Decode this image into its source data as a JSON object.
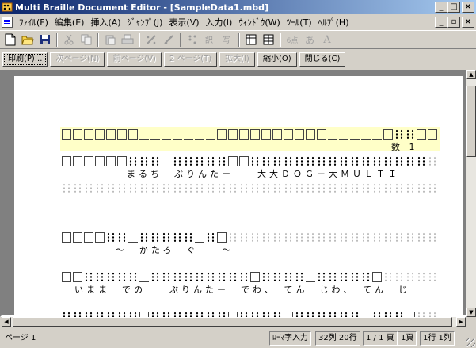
{
  "window": {
    "title": "Multi Braille Document Editor - [SampleData1.mbd]",
    "controls": {
      "minimize": "_",
      "restore": "□",
      "close": "×"
    }
  },
  "menu": {
    "items": [
      "ﾌｧｲﾙ(F)",
      "編集(E)",
      "挿入(A)",
      "ｼﾞｬﾝﾌﾟ(J)",
      "表示(V)",
      "入力(I)",
      "ｳｨﾝﾄﾞｳ(W)",
      "ﾂｰﾙ(T)",
      "ﾍﾙﾌﾟ(H)"
    ],
    "mdi_controls": {
      "minimize": "_",
      "restore": "▫",
      "close": "×"
    }
  },
  "toolbar": {
    "new_icon": "new-document-icon",
    "open_icon": "open-folder-icon",
    "save_icon": "save-icon",
    "cut_icon": "cut-icon",
    "copy_icon": "copy-icon",
    "paste_icon": "paste-icon",
    "print_icon": "print-icon",
    "kana_label": "6点",
    "hiragana_label": "あ",
    "latin_label": "A"
  },
  "preview_nav": {
    "print": "印刷(P)...",
    "next_page": "次ページ(N)",
    "prev_page": "前ページ(V)",
    "two_page": "2 ページ(T)",
    "zoom_in": "拡大(I)",
    "zoom_out": "縮小(O)",
    "close": "閉じる(C)"
  },
  "document": {
    "rows": [
      {
        "ink": "数 1",
        "highlighted": true
      },
      {
        "ink": "まるち　ぶりんたー　　大大ＤＯＧ－大ＭＵＬＴＩ",
        "highlighted": false
      },
      {
        "ink": "",
        "highlighted": false
      },
      {
        "ink": "～　かたろ　ぐ　　～",
        "highlighted": false
      },
      {
        "ink": "いまま　での　　ぶりんたー　でわ、　てん　じわ、　てん　じ",
        "highlighted": false
      },
      {
        "ink": "",
        "highlighted": false
      }
    ]
  },
  "status": {
    "page": "ページ 1",
    "input_mode": "ﾛｰﾏ字入力",
    "columns_rows": "32列 20行",
    "page_of": "1 / 1 頁",
    "current_page": "1頁",
    "cursor": "1行 1列"
  }
}
